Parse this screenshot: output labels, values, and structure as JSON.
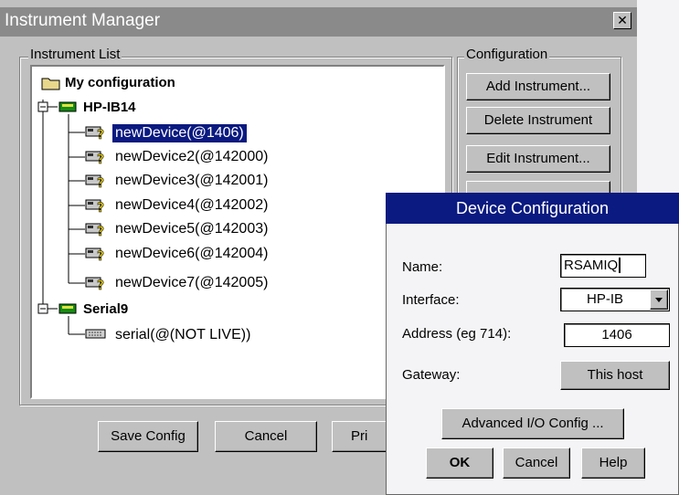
{
  "window": {
    "title": "Instrument Manager",
    "close_glyph": "✕"
  },
  "instrument_list": {
    "legend": "Instrument List",
    "root": "My configuration",
    "buses": [
      {
        "label": "HP-IB14",
        "devices": [
          "newDevice(@1406)",
          "newDevice2(@142000)",
          "newDevice3(@142001)",
          "newDevice4(@142002)",
          "newDevice5(@142003)",
          "newDevice6(@142004)",
          "newDevice7(@142005)"
        ],
        "selected_index": 0
      },
      {
        "label": "Serial9",
        "devices": [
          "serial(@(NOT LIVE))"
        ]
      }
    ]
  },
  "configuration": {
    "legend": "Configuration",
    "buttons": [
      "Add Instrument...",
      "Delete Instrument",
      "Edit Instrument..."
    ]
  },
  "bottom_buttons": {
    "save": "Save Config",
    "cancel": "Cancel",
    "print_partial": "Pri"
  },
  "device_dialog": {
    "title": "Device Configuration",
    "name_label": "Name:",
    "name_value": "RSAMIQ",
    "interface_label": "Interface:",
    "interface_value": "HP-IB",
    "address_label": "Address (eg 714):",
    "address_value": "1406",
    "gateway_label": "Gateway:",
    "gateway_value": "This host",
    "advanced_button": "Advanced I/O Config ...",
    "ok": "OK",
    "cancel": "Cancel",
    "help": "Help"
  },
  "colors": {
    "selection": "#0a1a80",
    "dialog_title": "#0a1a80",
    "window_bg": "#c0c0c0"
  }
}
